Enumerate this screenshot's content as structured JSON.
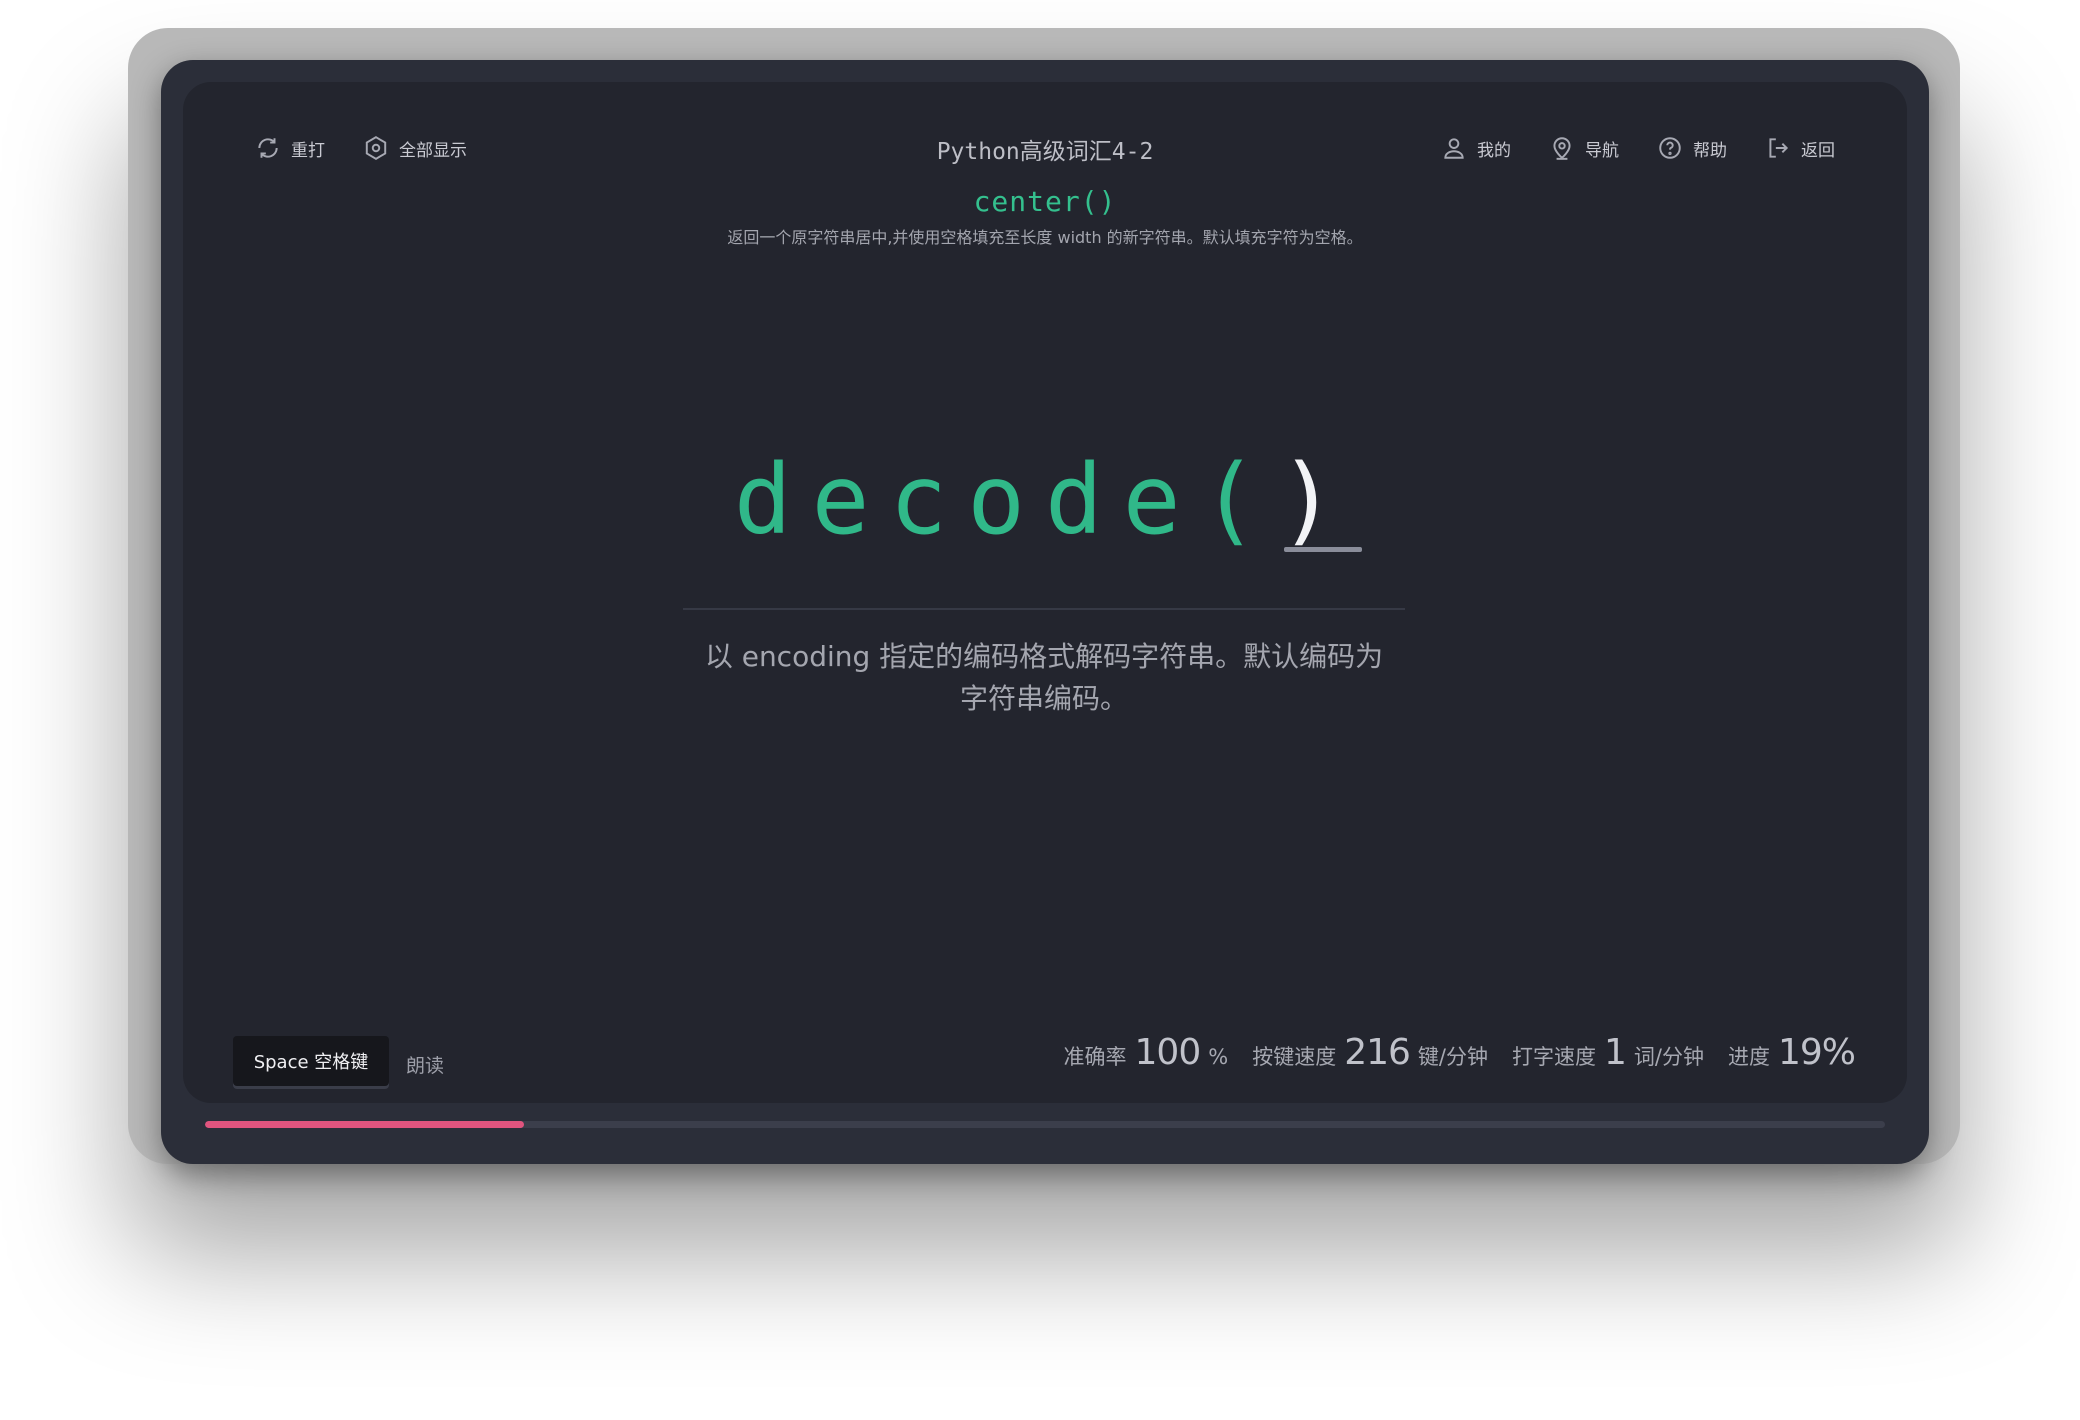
{
  "header": {
    "title": "Python高级词汇4-2",
    "left_tools": [
      {
        "label": "重打",
        "icon": "refresh-icon"
      },
      {
        "label": "全部显示",
        "icon": "eye-icon"
      }
    ],
    "right_tools": [
      {
        "label": "我的",
        "icon": "user-icon"
      },
      {
        "label": "导航",
        "icon": "location-icon"
      },
      {
        "label": "帮助",
        "icon": "help-icon"
      },
      {
        "label": "返回",
        "icon": "exit-icon"
      }
    ]
  },
  "previous": {
    "word": "center()",
    "definition": "返回一个原字符串居中,并使用空格填充至长度 width 的新字符串。默认填充字符为空格。"
  },
  "current": {
    "typed": "decode(",
    "pending": ")",
    "definition": "以 encoding 指定的编码格式解码字符串。默认编码为字符串编码。"
  },
  "footer": {
    "space_key": "Space 空格键",
    "read_aloud": "朗读",
    "stats": {
      "accuracy_label": "准确率",
      "accuracy_value": "100",
      "accuracy_unit": "%",
      "key_speed_label": "按键速度",
      "key_speed_value": "216",
      "key_speed_unit": "键/分钟",
      "word_speed_label": "打字速度",
      "word_speed_value": "1",
      "word_speed_unit": "词/分钟",
      "progress_label": "进度",
      "progress_value": "19%"
    }
  },
  "progress": 0.19,
  "colors": {
    "accent": "#30b889",
    "progress": "#e0547e",
    "screen": "#23252e"
  }
}
